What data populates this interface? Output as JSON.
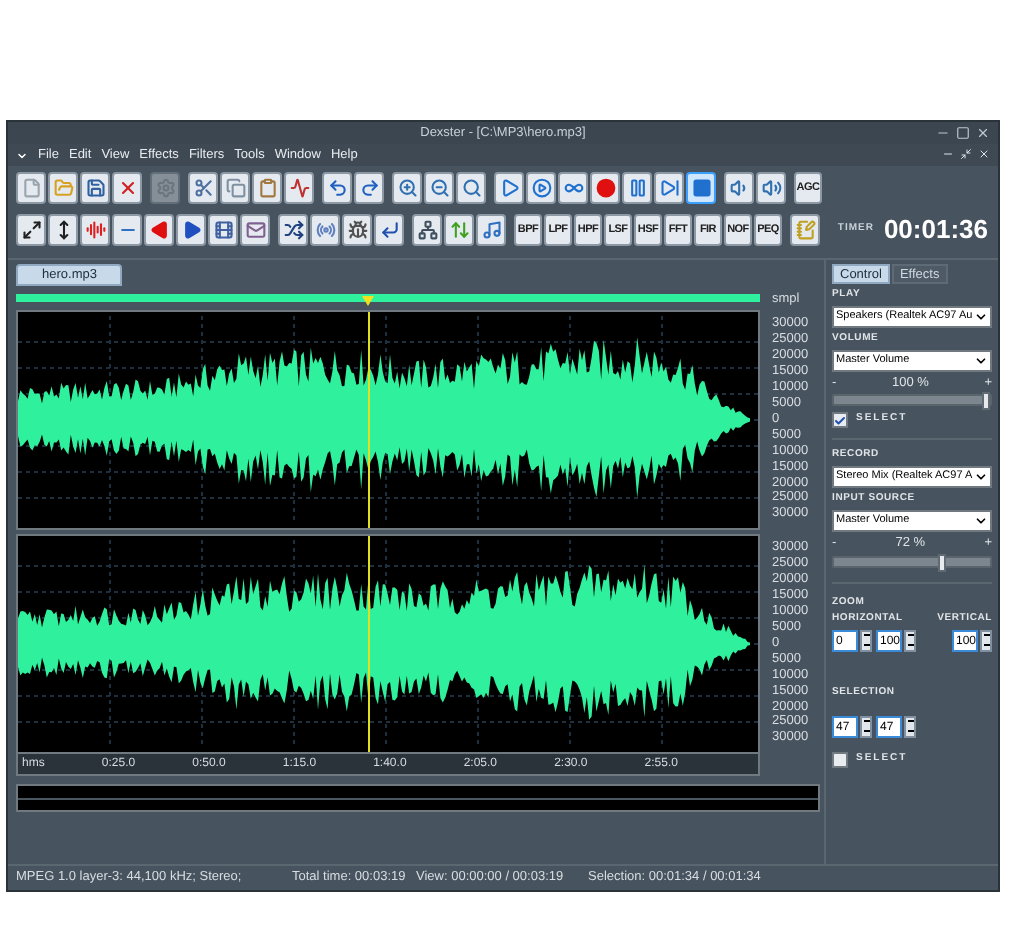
{
  "window": {
    "title": "Dexster - [C:\\MP3\\hero.mp3]"
  },
  "menu": [
    "File",
    "Edit",
    "View",
    "Effects",
    "Filters",
    "Tools",
    "Window",
    "Help"
  ],
  "toolbar_1": [
    {
      "kind": "icon",
      "selected": false,
      "disabled": false
    },
    {
      "kind": "icon",
      "selected": false,
      "disabled": false
    },
    {
      "kind": "icon",
      "selected": false,
      "disabled": false
    },
    {
      "kind": "icon",
      "selected": false,
      "disabled": false
    },
    {
      "kind": "icon",
      "selected": false,
      "disabled": true
    },
    {
      "kind": "icon",
      "selected": false,
      "disabled": false
    },
    {
      "kind": "icon",
      "selected": false,
      "disabled": false
    },
    {
      "kind": "icon",
      "selected": false,
      "disabled": false
    },
    {
      "kind": "icon",
      "selected": false,
      "disabled": false
    },
    {
      "kind": "icon",
      "selected": false,
      "disabled": false
    },
    {
      "kind": "icon",
      "selected": false,
      "disabled": false
    },
    {
      "kind": "icon",
      "selected": false,
      "disabled": false
    },
    {
      "kind": "icon",
      "selected": false,
      "disabled": false
    },
    {
      "kind": "icon",
      "selected": false,
      "disabled": false
    },
    {
      "kind": "icon",
      "selected": false,
      "disabled": false
    },
    {
      "kind": "icon",
      "selected": false,
      "disabled": false
    },
    {
      "kind": "icon",
      "selected": false,
      "disabled": false
    },
    {
      "kind": "icon",
      "selected": false,
      "disabled": false
    },
    {
      "kind": "icon",
      "selected": false,
      "disabled": false
    },
    {
      "kind": "icon",
      "selected": false,
      "disabled": false
    },
    {
      "kind": "icon",
      "selected": true,
      "disabled": false
    },
    {
      "kind": "icon",
      "selected": false,
      "disabled": false
    },
    {
      "kind": "icon",
      "selected": false,
      "disabled": false
    },
    {
      "kind": "text",
      "label": "AGC",
      "selected": false,
      "disabled": false
    }
  ],
  "toolbar_2": [
    {
      "kind": "icon"
    },
    {
      "kind": "icon"
    },
    {
      "kind": "icon"
    },
    {
      "kind": "icon"
    },
    {
      "kind": "icon"
    },
    {
      "kind": "icon"
    },
    {
      "kind": "icon"
    },
    {
      "kind": "icon"
    },
    {
      "kind": "icon"
    },
    {
      "kind": "icon"
    },
    {
      "kind": "icon"
    },
    {
      "kind": "icon"
    },
    {
      "kind": "icon"
    },
    {
      "kind": "icon"
    },
    {
      "kind": "icon"
    },
    {
      "kind": "text",
      "label": "BPF"
    },
    {
      "kind": "text",
      "label": "LPF"
    },
    {
      "kind": "text",
      "label": "HPF"
    },
    {
      "kind": "text",
      "label": "LSF"
    },
    {
      "kind": "text",
      "label": "HSF"
    },
    {
      "kind": "text",
      "label": "FFT"
    },
    {
      "kind": "text",
      "label": "FIR"
    },
    {
      "kind": "text",
      "label": "NOF"
    },
    {
      "kind": "text",
      "label": "PEQ"
    },
    {
      "kind": "icon"
    }
  ],
  "timer": {
    "label": "TIMER",
    "value": "00:01:36"
  },
  "document_tabs": [
    {
      "label": "hero.mp3",
      "selected": true
    }
  ],
  "waveform": {
    "y_unit": "smpl",
    "channels": [
      {
        "yticks": [
          "30000",
          "25000",
          "20000",
          "15000",
          "10000",
          "5000",
          "0",
          "5000",
          "10000",
          "15000",
          "20000",
          "25000",
          "30000"
        ]
      },
      {
        "yticks": [
          "30000",
          "25000",
          "20000",
          "15000",
          "10000",
          "5000",
          "0",
          "5000",
          "10000",
          "15000",
          "20000",
          "25000",
          "30000"
        ]
      }
    ],
    "x_unit": "hms",
    "xticks": [
      "0:25.0",
      "0:50.0",
      "1:15.0",
      "1:40.0",
      "2:05.0",
      "2:30.0",
      "2:55.0"
    ]
  },
  "panel": {
    "tabs": [
      {
        "label": "Control",
        "selected": true
      },
      {
        "label": "Effects",
        "selected": false
      }
    ],
    "play": {
      "label": "PLAY",
      "device": "Speakers (Realtek AC97 Au",
      "volume_label": "VOLUME",
      "volume_source": "Master Volume",
      "minus": "-",
      "plus": "+",
      "reading": "100 %",
      "level": 1.0,
      "select_label": "SELECT",
      "select_checked": true
    },
    "record": {
      "label": "RECORD",
      "device": "Stereo Mix (Realtek AC97 A",
      "source_label": "INPUT SOURCE",
      "source": "Master Volume",
      "minus": "-",
      "plus": "+",
      "reading": "72 %",
      "level": 0.72
    },
    "zoom": {
      "label": "ZOOM",
      "horizontal_label": "HORIZONTAL",
      "vertical_label": "VERTICAL",
      "horizontal_from": "0",
      "horizontal_to": "100",
      "vertical": "100"
    },
    "selection": {
      "label": "SELECTION",
      "from": "47",
      "to": "47"
    },
    "select_label": "SELECT",
    "select_checked": false
  },
  "status_bar": [
    "MPEG 1.0 layer-3: 44,100 kHz; Stereo;",
    "Total time: 00:03:19",
    "View: 00:00:00 / 00:03:19",
    "Selection: 00:01:34 / 00:01:34"
  ]
}
